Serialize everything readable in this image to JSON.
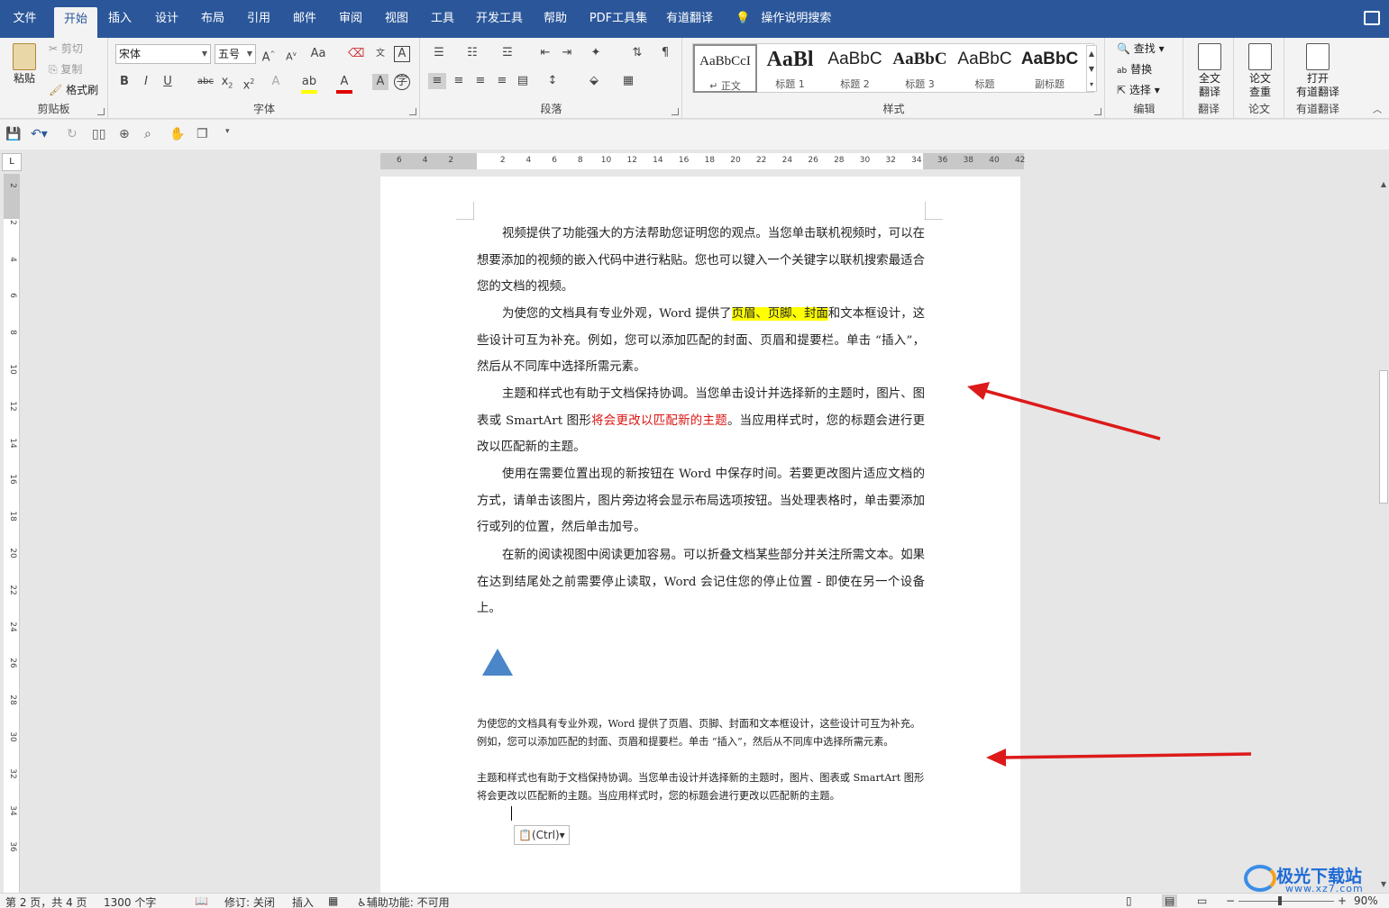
{
  "tabs": [
    "文件",
    "开始",
    "插入",
    "设计",
    "布局",
    "引用",
    "邮件",
    "审阅",
    "视图",
    "工具",
    "开发工具",
    "帮助",
    "PDF工具集",
    "有道翻译"
  ],
  "tell_me": "操作说明搜索",
  "ribbon": {
    "clipboard": {
      "paste": "粘贴",
      "cut": "剪切",
      "copy": "复制",
      "format_painter": "格式刷",
      "label": "剪贴板"
    },
    "font": {
      "name": "宋体",
      "size": "五号",
      "label": "字体",
      "case_btn": "Aa"
    },
    "paragraph": {
      "label": "段落"
    },
    "styles": {
      "label": "样式",
      "items": [
        {
          "preview": "AaBbCcI",
          "name": "↵ 正文"
        },
        {
          "preview": "AaBl",
          "name": "标题 1"
        },
        {
          "preview": "AaBbC",
          "name": "标题 2"
        },
        {
          "preview": "AaBbC",
          "name": "标题 3"
        },
        {
          "preview": "AaBbC",
          "name": "标题"
        },
        {
          "preview": "AaBbC",
          "name": "副标题"
        }
      ]
    },
    "editing": {
      "find": "查找",
      "replace": "替换",
      "select": "选择",
      "label": "编辑"
    },
    "translate": {
      "full_l1": "全文",
      "full_l2": "翻译",
      "label": "翻译"
    },
    "paper": {
      "check_l1": "论文",
      "check_l2": "查重",
      "label": "论文"
    },
    "youdao": {
      "open_l1": "打开",
      "open_l2": "有道翻译",
      "label": "有道翻译"
    }
  },
  "ruler": {
    "left_nums": [
      "6",
      "4",
      "2"
    ],
    "nums": [
      "2",
      "4",
      "6",
      "8",
      "10",
      "12",
      "14",
      "16",
      "18",
      "20",
      "22",
      "24",
      "26",
      "28",
      "30",
      "32",
      "34"
    ],
    "right_nums": [
      "36",
      "38",
      "40",
      "42"
    ],
    "v_nums": [
      "2",
      "2",
      "4",
      "6",
      "8",
      "10",
      "12",
      "14",
      "16",
      "18",
      "20",
      "22",
      "24",
      "26",
      "28",
      "30",
      "32",
      "34",
      "36"
    ],
    "corner": "L"
  },
  "doc": {
    "p1": "视频提供了功能强大的方法帮助您证明您的观点。当您单击联机视频时，可以在想要添加的视频的嵌入代码中进行粘贴。您也可以键入一个关键字以联机搜索最适合您的文档的视频。",
    "p2_a": "为使您的文档具有专业外观，Word 提供了",
    "p2_hl": "页眉、页脚、封面",
    "p2_b": "和文本框设计，这些设计可互为补充。例如，您可以添加匹配的封面、页眉和提要栏。单击 “插入”，然后从不同库中选择所需元素。",
    "p3_a": "主题和样式也有助于文档保持协调。当您单击设计并选择新的主题时，图片、图表或 SmartArt 图形",
    "p3_red": "将会更改以匹配新的主题",
    "p3_b": "。当应用样式时，您的标题会进行更改以匹配新的主题。",
    "p4": "使用在需要位置出现的新按钮在 Word 中保存时间。若要更改图片适应文档的方式，请单击该图片，图片旁边将会显示布局选项按钮。当处理表格时，单击要添加行或列的位置，然后单击加号。",
    "p5": "在新的阅读视图中阅读更加容易。可以折叠文档某些部分并关注所需文本。如果在达到结尾处之前需要停止读取，Word 会记住您的停止位置 - 即使在另一个设备上。",
    "s1": "为使您的文档具有专业外观，Word 提供了页眉、页脚、封面和文本框设计，这些设计可互为补充。例如，您可以添加匹配的封面、页眉和提要栏。单击 “插入”，然后从不同库中选择所需元素。",
    "s2": "主题和样式也有助于文档保持协调。当您单击设计并选择新的主题时，图片、图表或 SmartArt 图形将会更改以匹配新的主题。当应用样式时，您的标题会进行更改以匹配新的主题。",
    "paste_options": "(Ctrl)"
  },
  "status": {
    "page": "第 2 页，共 4 页",
    "words": "1300 个字",
    "track": "修订: 关闭",
    "insert": "插入",
    "accessibility": "辅助功能: 不可用",
    "zoom": "90%"
  },
  "watermark": {
    "name": "极光下载站",
    "url": "www.xz7.com"
  },
  "colors": {
    "ribbon_blue": "#2b579a",
    "highlight": "#ffff00",
    "red_text": "#dd1111",
    "arrow": "#dd1a1a",
    "shape": "#4a86c8"
  }
}
